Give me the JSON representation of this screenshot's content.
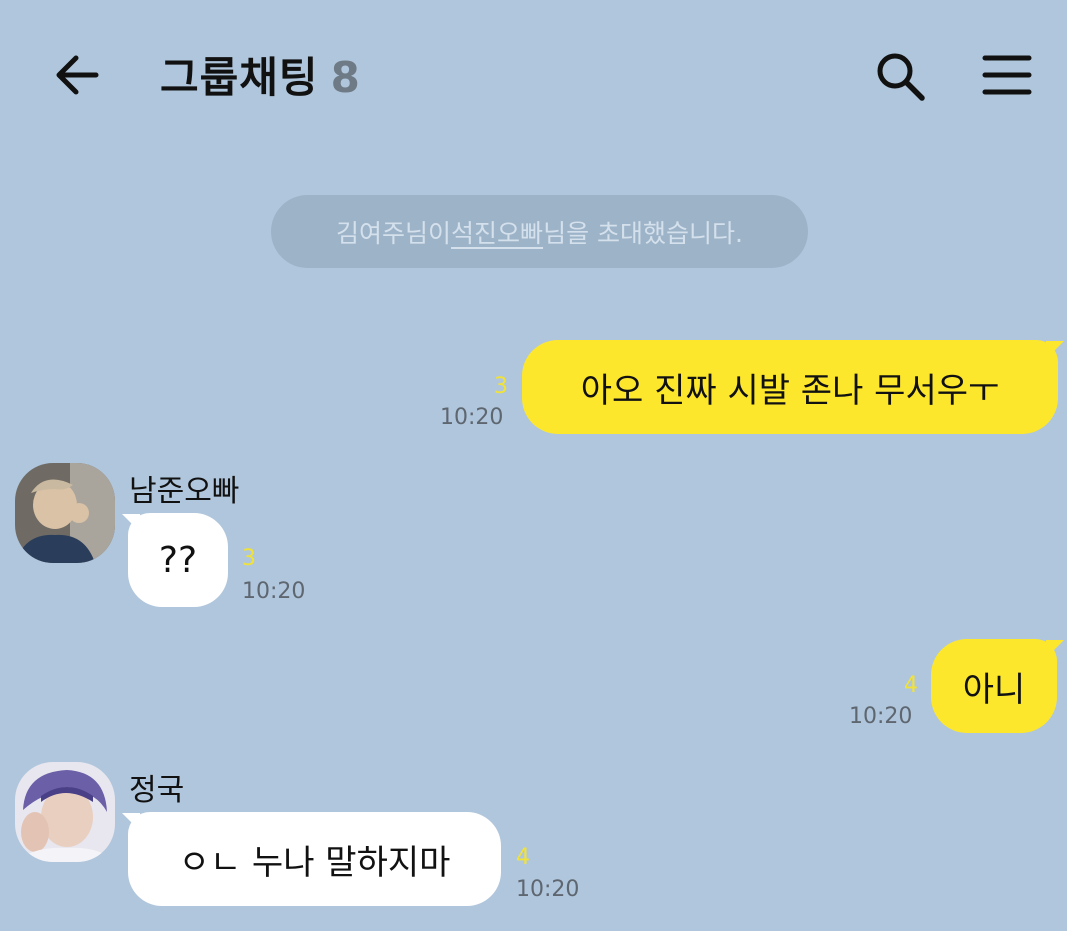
{
  "header": {
    "title": "그룹채팅",
    "member_count": "8"
  },
  "system_notice": {
    "inviter": "김여주님이 ",
    "invitee": "석진오빠",
    "suffix": "님을 초대했습니다."
  },
  "messages": [
    {
      "side": "right",
      "text": "아오 진짜 시발 존나 무서우ㅜ",
      "unread": "3",
      "time": "10:20"
    },
    {
      "side": "left",
      "sender": "남준오빠",
      "text": "??",
      "unread": "3",
      "time": "10:20"
    },
    {
      "side": "right",
      "text": "아니",
      "unread": "4",
      "time": "10:20"
    },
    {
      "side": "left",
      "sender": "정국",
      "text": "ㅇㄴ 누나 말하지마",
      "unread": "4",
      "time": "10:20"
    }
  ],
  "colors": {
    "background": "#b0c6dc",
    "my_bubble": "#fde72d",
    "their_bubble": "#ffffff",
    "unread_count": "#f1e23a"
  },
  "icons": [
    "back-arrow-icon",
    "search-icon",
    "menu-icon"
  ]
}
